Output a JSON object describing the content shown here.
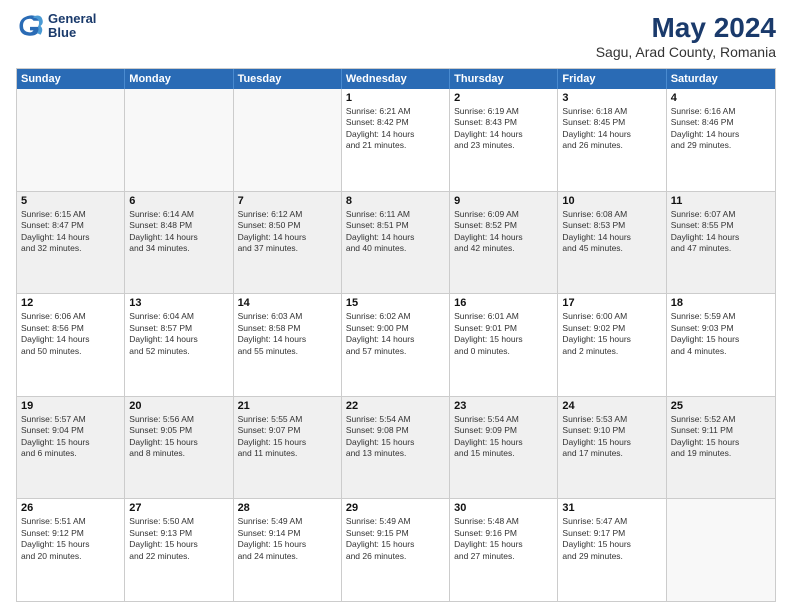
{
  "header": {
    "logo_line1": "General",
    "logo_line2": "Blue",
    "title": "May 2024",
    "subtitle": "Sagu, Arad County, Romania"
  },
  "weekdays": [
    "Sunday",
    "Monday",
    "Tuesday",
    "Wednesday",
    "Thursday",
    "Friday",
    "Saturday"
  ],
  "rows": [
    [
      {
        "day": "",
        "text": "",
        "empty": true
      },
      {
        "day": "",
        "text": "",
        "empty": true
      },
      {
        "day": "",
        "text": "",
        "empty": true
      },
      {
        "day": "1",
        "text": "Sunrise: 6:21 AM\nSunset: 8:42 PM\nDaylight: 14 hours\nand 21 minutes."
      },
      {
        "day": "2",
        "text": "Sunrise: 6:19 AM\nSunset: 8:43 PM\nDaylight: 14 hours\nand 23 minutes."
      },
      {
        "day": "3",
        "text": "Sunrise: 6:18 AM\nSunset: 8:45 PM\nDaylight: 14 hours\nand 26 minutes."
      },
      {
        "day": "4",
        "text": "Sunrise: 6:16 AM\nSunset: 8:46 PM\nDaylight: 14 hours\nand 29 minutes."
      }
    ],
    [
      {
        "day": "5",
        "text": "Sunrise: 6:15 AM\nSunset: 8:47 PM\nDaylight: 14 hours\nand 32 minutes.",
        "shaded": true
      },
      {
        "day": "6",
        "text": "Sunrise: 6:14 AM\nSunset: 8:48 PM\nDaylight: 14 hours\nand 34 minutes.",
        "shaded": true
      },
      {
        "day": "7",
        "text": "Sunrise: 6:12 AM\nSunset: 8:50 PM\nDaylight: 14 hours\nand 37 minutes.",
        "shaded": true
      },
      {
        "day": "8",
        "text": "Sunrise: 6:11 AM\nSunset: 8:51 PM\nDaylight: 14 hours\nand 40 minutes.",
        "shaded": true
      },
      {
        "day": "9",
        "text": "Sunrise: 6:09 AM\nSunset: 8:52 PM\nDaylight: 14 hours\nand 42 minutes.",
        "shaded": true
      },
      {
        "day": "10",
        "text": "Sunrise: 6:08 AM\nSunset: 8:53 PM\nDaylight: 14 hours\nand 45 minutes.",
        "shaded": true
      },
      {
        "day": "11",
        "text": "Sunrise: 6:07 AM\nSunset: 8:55 PM\nDaylight: 14 hours\nand 47 minutes.",
        "shaded": true
      }
    ],
    [
      {
        "day": "12",
        "text": "Sunrise: 6:06 AM\nSunset: 8:56 PM\nDaylight: 14 hours\nand 50 minutes."
      },
      {
        "day": "13",
        "text": "Sunrise: 6:04 AM\nSunset: 8:57 PM\nDaylight: 14 hours\nand 52 minutes."
      },
      {
        "day": "14",
        "text": "Sunrise: 6:03 AM\nSunset: 8:58 PM\nDaylight: 14 hours\nand 55 minutes."
      },
      {
        "day": "15",
        "text": "Sunrise: 6:02 AM\nSunset: 9:00 PM\nDaylight: 14 hours\nand 57 minutes."
      },
      {
        "day": "16",
        "text": "Sunrise: 6:01 AM\nSunset: 9:01 PM\nDaylight: 15 hours\nand 0 minutes."
      },
      {
        "day": "17",
        "text": "Sunrise: 6:00 AM\nSunset: 9:02 PM\nDaylight: 15 hours\nand 2 minutes."
      },
      {
        "day": "18",
        "text": "Sunrise: 5:59 AM\nSunset: 9:03 PM\nDaylight: 15 hours\nand 4 minutes."
      }
    ],
    [
      {
        "day": "19",
        "text": "Sunrise: 5:57 AM\nSunset: 9:04 PM\nDaylight: 15 hours\nand 6 minutes.",
        "shaded": true
      },
      {
        "day": "20",
        "text": "Sunrise: 5:56 AM\nSunset: 9:05 PM\nDaylight: 15 hours\nand 8 minutes.",
        "shaded": true
      },
      {
        "day": "21",
        "text": "Sunrise: 5:55 AM\nSunset: 9:07 PM\nDaylight: 15 hours\nand 11 minutes.",
        "shaded": true
      },
      {
        "day": "22",
        "text": "Sunrise: 5:54 AM\nSunset: 9:08 PM\nDaylight: 15 hours\nand 13 minutes.",
        "shaded": true
      },
      {
        "day": "23",
        "text": "Sunrise: 5:54 AM\nSunset: 9:09 PM\nDaylight: 15 hours\nand 15 minutes.",
        "shaded": true
      },
      {
        "day": "24",
        "text": "Sunrise: 5:53 AM\nSunset: 9:10 PM\nDaylight: 15 hours\nand 17 minutes.",
        "shaded": true
      },
      {
        "day": "25",
        "text": "Sunrise: 5:52 AM\nSunset: 9:11 PM\nDaylight: 15 hours\nand 19 minutes.",
        "shaded": true
      }
    ],
    [
      {
        "day": "26",
        "text": "Sunrise: 5:51 AM\nSunset: 9:12 PM\nDaylight: 15 hours\nand 20 minutes."
      },
      {
        "day": "27",
        "text": "Sunrise: 5:50 AM\nSunset: 9:13 PM\nDaylight: 15 hours\nand 22 minutes."
      },
      {
        "day": "28",
        "text": "Sunrise: 5:49 AM\nSunset: 9:14 PM\nDaylight: 15 hours\nand 24 minutes."
      },
      {
        "day": "29",
        "text": "Sunrise: 5:49 AM\nSunset: 9:15 PM\nDaylight: 15 hours\nand 26 minutes."
      },
      {
        "day": "30",
        "text": "Sunrise: 5:48 AM\nSunset: 9:16 PM\nDaylight: 15 hours\nand 27 minutes."
      },
      {
        "day": "31",
        "text": "Sunrise: 5:47 AM\nSunset: 9:17 PM\nDaylight: 15 hours\nand 29 minutes."
      },
      {
        "day": "",
        "text": "",
        "empty": true
      }
    ]
  ]
}
